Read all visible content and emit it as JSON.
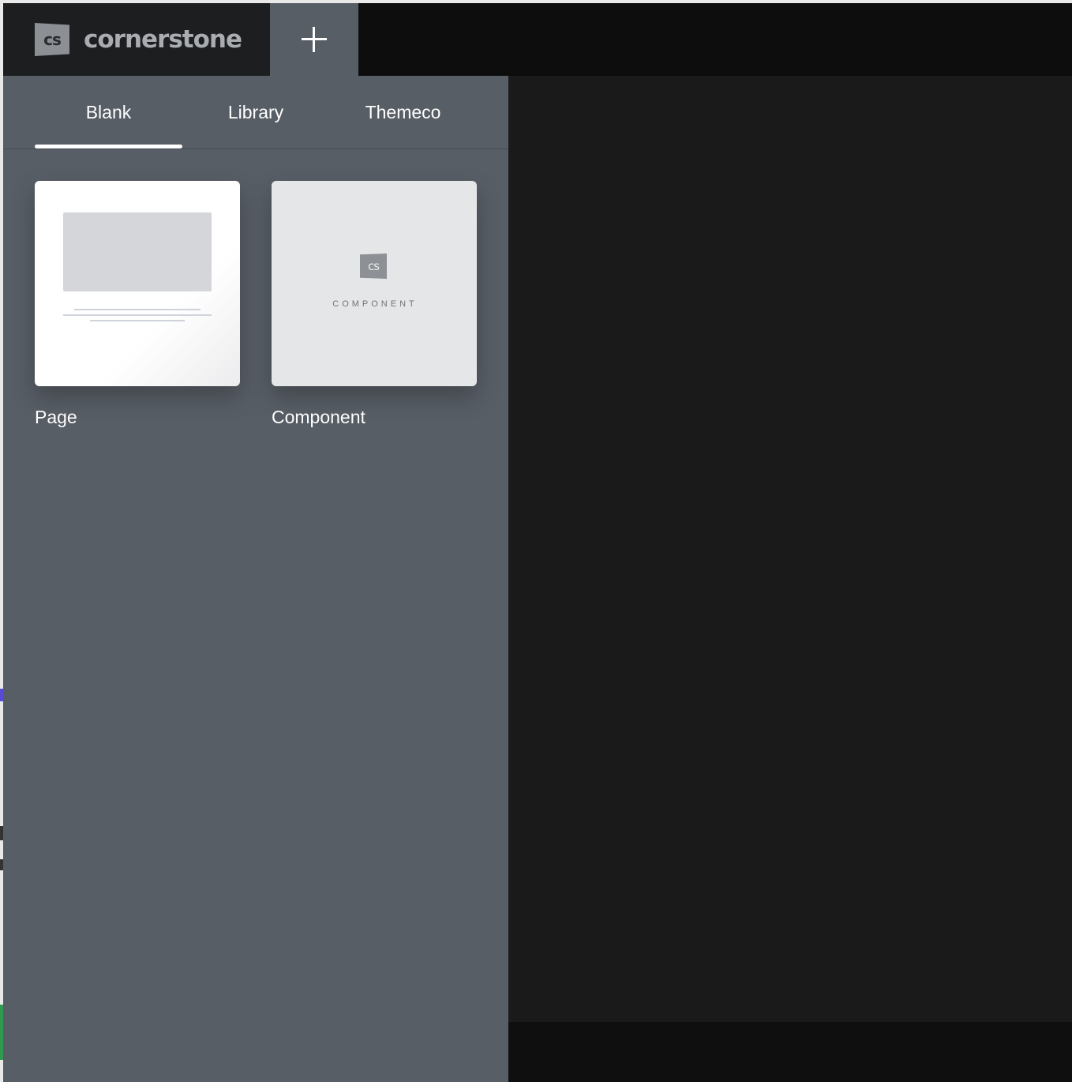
{
  "header": {
    "brand_badge": "cs",
    "brand_name": "cornerstone",
    "add_icon": "plus-icon"
  },
  "panel": {
    "tabs": [
      {
        "label": "Blank",
        "active": true
      },
      {
        "label": "Library",
        "active": false
      },
      {
        "label": "Themeco",
        "active": false
      }
    ],
    "cards": [
      {
        "label": "Page",
        "thumbnail": "page-preview"
      },
      {
        "label": "Component",
        "thumbnail": "component-preview",
        "badge": "cs",
        "caption": "COMPONENT"
      }
    ]
  },
  "colors": {
    "panel_bg": "#585e66",
    "topbar_bg": "#0d0d0d",
    "brand_bg": "#1d1e20",
    "work_area_bg": "#1a1a1a",
    "active_tab_underline": "#ffffff"
  }
}
